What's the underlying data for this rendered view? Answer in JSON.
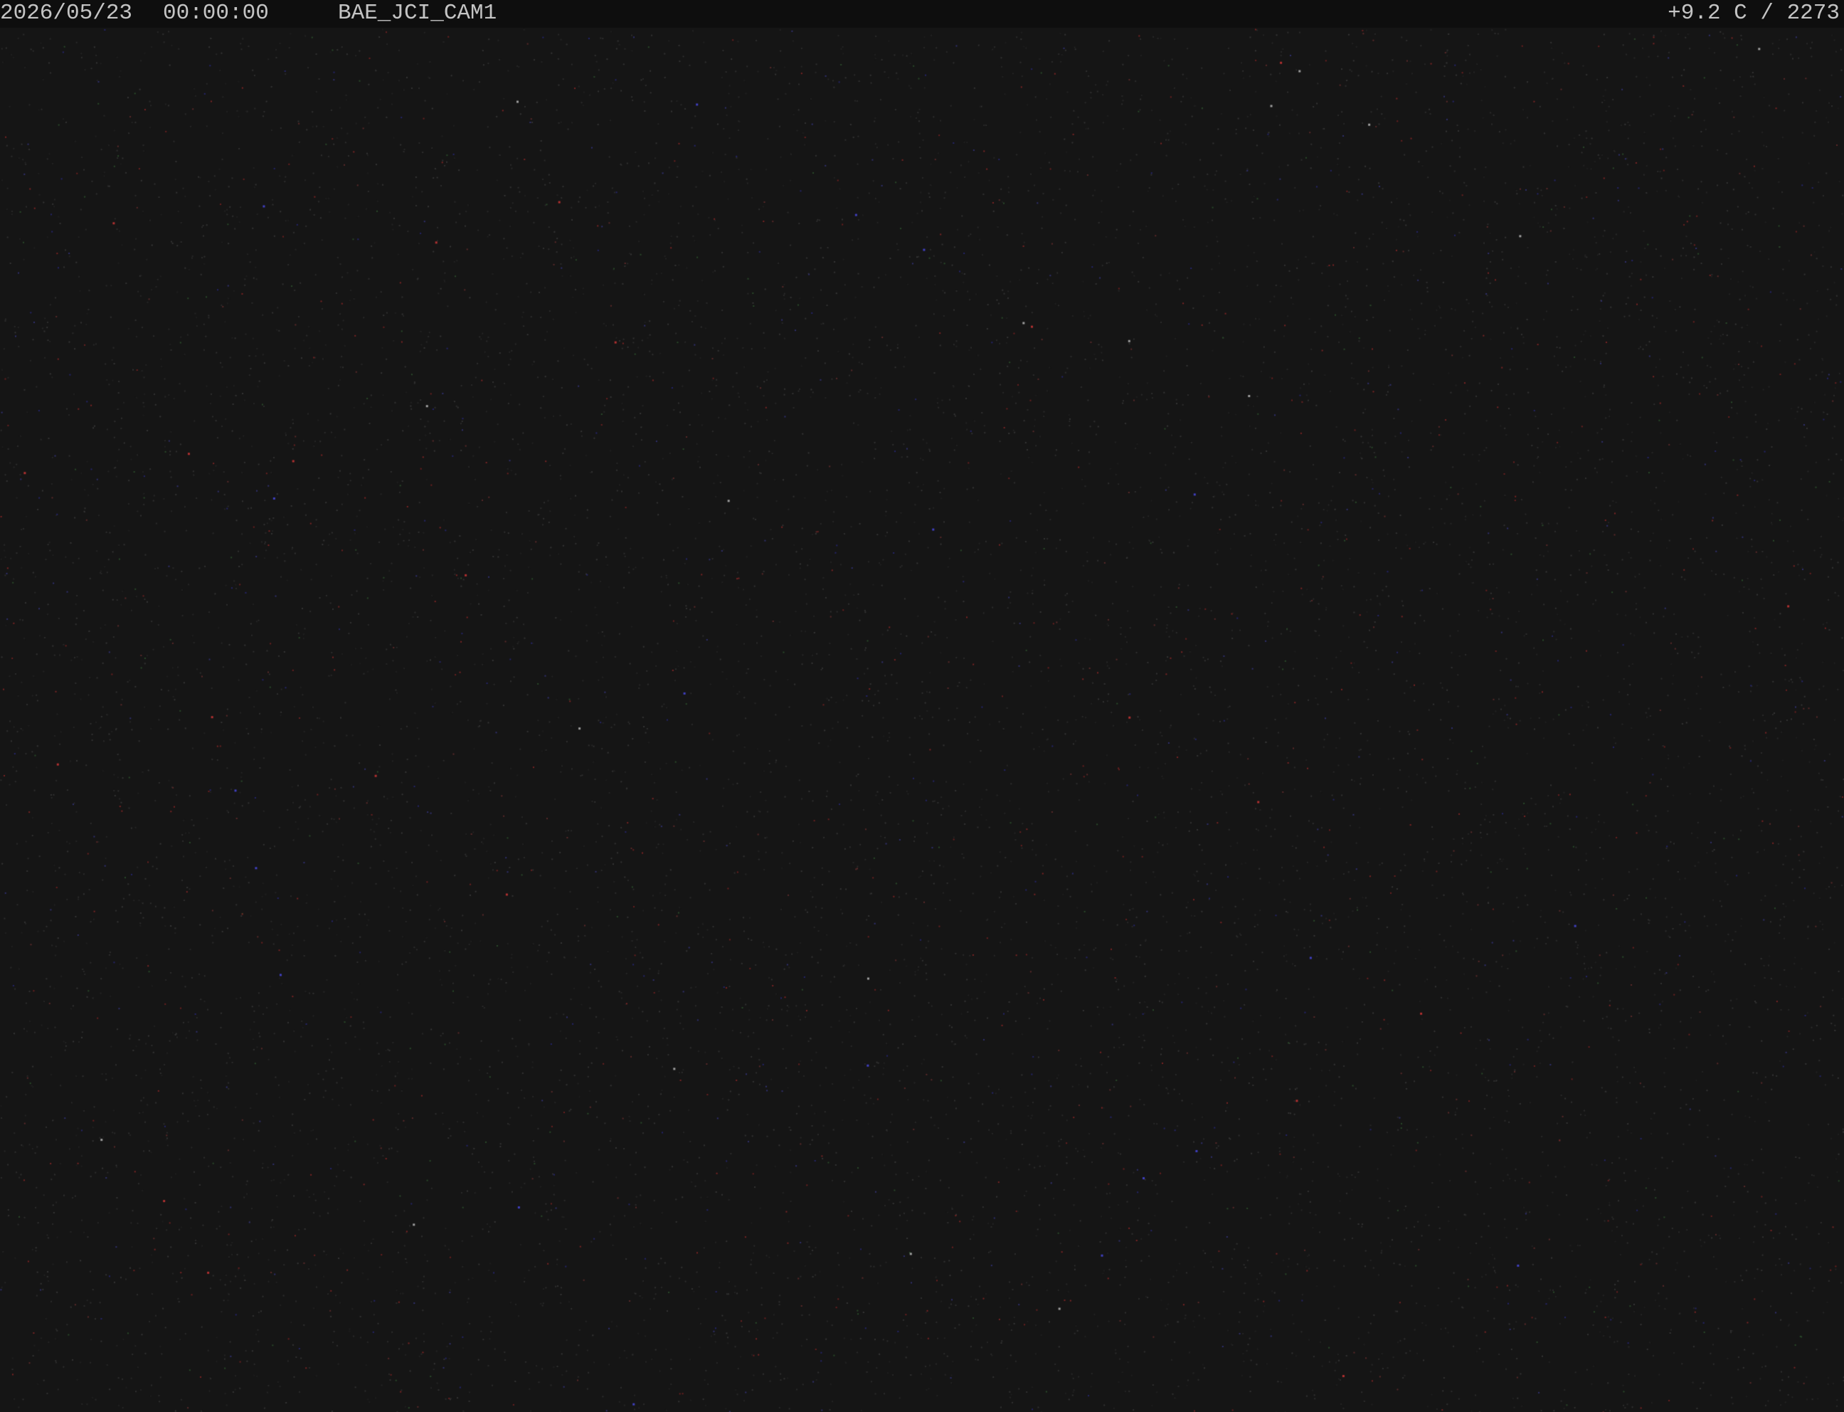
{
  "overlay": {
    "date": "2026/05/23",
    "time": "00:00:00",
    "camera_name": "BAE_JCI_CAM1",
    "right_text": "+9.2 C / 2273"
  },
  "scene": {
    "background_color": "#151515",
    "bar_color": "#0e0e0e",
    "text_color": "#c4c4c4"
  }
}
